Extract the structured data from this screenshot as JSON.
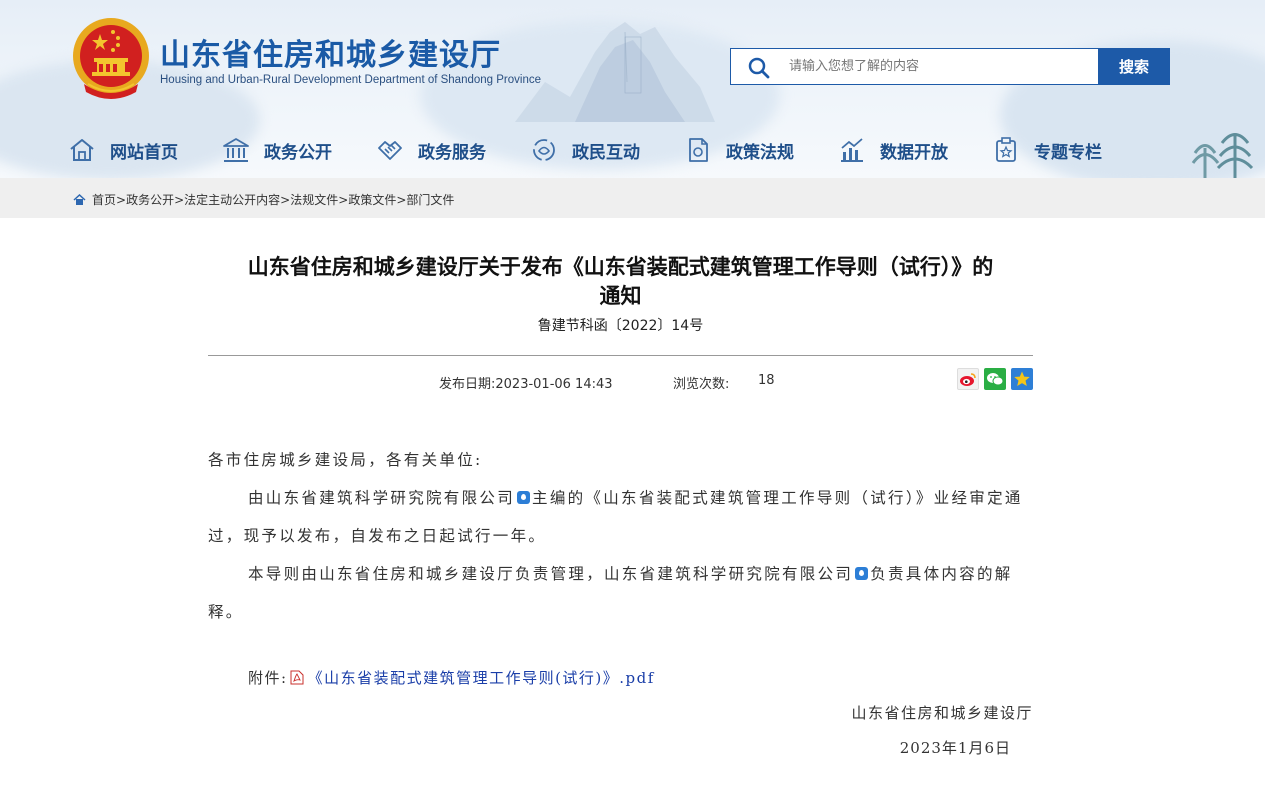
{
  "site": {
    "title_cn": "山东省住房和城乡建设厅",
    "title_en": "Housing and Urban-Rural Development Department of Shandong Province"
  },
  "search": {
    "placeholder": "请输入您想了解的内容",
    "button_label": "搜索"
  },
  "nav": {
    "items": [
      {
        "label": "网站首页",
        "icon": "home-icon"
      },
      {
        "label": "政务公开",
        "icon": "government-building-icon"
      },
      {
        "label": "政务服务",
        "icon": "handshake-icon"
      },
      {
        "label": "政民互动",
        "icon": "interaction-icon"
      },
      {
        "label": "政策法规",
        "icon": "policy-document-icon"
      },
      {
        "label": "数据开放",
        "icon": "data-chart-icon"
      },
      {
        "label": "专题专栏",
        "icon": "topic-column-icon"
      }
    ]
  },
  "breadcrumb": {
    "items": [
      "首页",
      "政务公开",
      "法定主动公开内容",
      "法规文件",
      "政策文件",
      "部门文件"
    ],
    "separator": ">"
  },
  "article": {
    "title_line1": "山东省住房和城乡建设厅关于发布《山东省装配式建筑管理工作导则（试行）》的",
    "title_line2": "通知",
    "doc_number": "鲁建节科函〔2022〕14号",
    "publish_date": "发布日期:2023-01-06 14:43",
    "views_label": "浏览次数:",
    "views_value": "18",
    "salutation": "各市住房城乡建设局，各有关单位:",
    "para1_a": "由山东省建筑科学研究院有限公司",
    "para1_b": "主编的《山东省装配式建筑管理工作导则（试行）》业经审定通过，现予以发布，自发布之日起试行一年。",
    "para2_a": "本导则由山东省住房和城乡建设厅负责管理，山东省建筑科学研究院有限公司",
    "para2_b": "负责具体内容的解释。",
    "attachment_label": "附件:",
    "attachment_link": "《山东省装配式建筑管理工作导则(试行)》.pdf",
    "signature": "山东省住房和城乡建设厅",
    "sign_date": "2023年1月6日"
  },
  "share": [
    "weibo-icon",
    "wechat-icon",
    "qzone-icon"
  ],
  "colors": {
    "brand_blue": "#1d5aa8",
    "nav_text": "#1f4f8a",
    "link": "#1a3ea8"
  }
}
